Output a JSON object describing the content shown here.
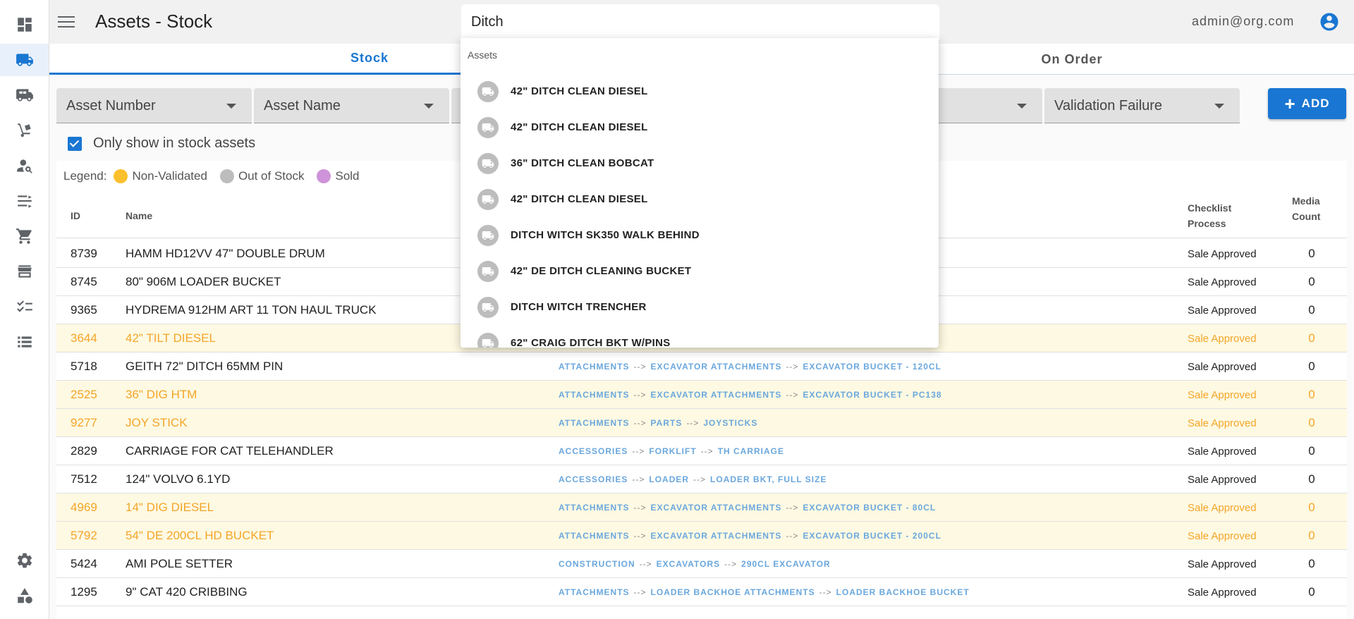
{
  "header": {
    "title": "Assets - Stock",
    "search_value": "Ditch",
    "user_email": "admin@org.com"
  },
  "tabs": [
    {
      "label": "Stock",
      "active": true
    },
    {
      "label": "On Order",
      "active": false
    }
  ],
  "filters": {
    "asset_number": "Asset Number",
    "asset_name": "Asset Name",
    "validation_failure": "Validation Failure",
    "add_label": "ADD"
  },
  "only_in_stock": {
    "label": "Only show in stock assets",
    "checked": true
  },
  "legend": {
    "label": "Legend:",
    "entries": [
      {
        "label": "Non-Validated",
        "color": "#fbc02d"
      },
      {
        "label": "Out of Stock",
        "color": "#bdbdbd"
      },
      {
        "label": "Sold",
        "color": "#ce93d8"
      }
    ]
  },
  "table": {
    "columns": {
      "id": "ID",
      "name": "Name",
      "checklist_1": "Checklist",
      "checklist_2": "Process",
      "media_1": "Media",
      "media_2": "Count"
    },
    "rows": [
      {
        "id": "8739",
        "name": "HAMM HD12VV 47\" DOUBLE DRUM",
        "cat": [
          "",
          "",
          ""
        ],
        "checklist": "Sale Approved",
        "media": "0",
        "nonval": false
      },
      {
        "id": "8745",
        "name": "80\" 906M LOADER BUCKET",
        "cat": [
          "",
          "",
          ""
        ],
        "checklist": "Sale Approved",
        "media": "0",
        "nonval": false
      },
      {
        "id": "9365",
        "name": "HYDREMA 912HM ART 11 TON HAUL TRUCK",
        "cat": [
          "",
          "",
          ""
        ],
        "checklist": "Sale Approved",
        "media": "0",
        "nonval": false
      },
      {
        "id": "3644",
        "name": "42\" TILT DIESEL",
        "cat": [
          "",
          "",
          ""
        ],
        "checklist": "Sale Approved",
        "media": "0",
        "nonval": true
      },
      {
        "id": "5718",
        "name": "GEITH 72\" DITCH 65MM PIN",
        "cat": [
          "ATTACHMENTS",
          "EXCAVATOR ATTACHMENTS",
          "EXCAVATOR BUCKET - 120CL"
        ],
        "checklist": "Sale Approved",
        "media": "0",
        "nonval": false
      },
      {
        "id": "2525",
        "name": "36\" DIG HTM",
        "cat": [
          "ATTACHMENTS",
          "EXCAVATOR ATTACHMENTS",
          "EXCAVATOR BUCKET - PC138"
        ],
        "checklist": "Sale Approved",
        "media": "0",
        "nonval": true
      },
      {
        "id": "9277",
        "name": "JOY STICK",
        "cat": [
          "ATTACHMENTS",
          "PARTS",
          "JOYSTICKS"
        ],
        "checklist": "Sale Approved",
        "media": "0",
        "nonval": true
      },
      {
        "id": "2829",
        "name": "CARRIAGE FOR CAT TELEHANDLER",
        "cat": [
          "ACCESSORIES",
          "FORKLIFT",
          "TH CARRIAGE"
        ],
        "checklist": "Sale Approved",
        "media": "0",
        "nonval": false
      },
      {
        "id": "7512",
        "name": "124\" VOLVO 6.1YD",
        "cat": [
          "ACCESSORIES",
          "LOADER",
          "LOADER BKT, FULL SIZE"
        ],
        "checklist": "Sale Approved",
        "media": "0",
        "nonval": false
      },
      {
        "id": "4969",
        "name": "14\" DIG DIESEL",
        "cat": [
          "ATTACHMENTS",
          "EXCAVATOR ATTACHMENTS",
          "EXCAVATOR BUCKET - 80CL"
        ],
        "checklist": "Sale Approved",
        "media": "0",
        "nonval": true
      },
      {
        "id": "5792",
        "name": "54\" DE 200CL HD BUCKET",
        "cat": [
          "ATTACHMENTS",
          "EXCAVATOR ATTACHMENTS",
          "EXCAVATOR BUCKET - 200CL"
        ],
        "checklist": "Sale Approved",
        "media": "0",
        "nonval": true
      },
      {
        "id": "5424",
        "name": "AMI POLE SETTER",
        "cat": [
          "CONSTRUCTION",
          "EXCAVATORS",
          "290CL EXCAVATOR"
        ],
        "checklist": "Sale Approved",
        "media": "0",
        "nonval": false
      },
      {
        "id": "1295",
        "name": "9\" CAT 420 CRIBBING",
        "cat": [
          "ATTACHMENTS",
          "LOADER BACKHOE ATTACHMENTS",
          "LOADER BACKHOE BUCKET"
        ],
        "checklist": "Sale Approved",
        "media": "0",
        "nonval": false
      }
    ],
    "arrow": "-->"
  },
  "dropdown": {
    "header": "Assets",
    "items": [
      "42\" DITCH CLEAN DIESEL",
      "42\" DITCH CLEAN DIESEL",
      "36\" DITCH CLEAN BOBCAT",
      "42\" DITCH CLEAN DIESEL",
      "DITCH WITCH SK350 WALK BEHIND",
      "42\" DE DITCH CLEANING BUCKET",
      "DITCH WITCH TRENCHER",
      "62\" CRAIG DITCH BKT W/PINS"
    ]
  },
  "sidebar": {
    "items": [
      {
        "icon": "dashboard-icon",
        "active": false
      },
      {
        "icon": "truck-icon",
        "active": true
      },
      {
        "icon": "truck-loaded-icon",
        "active": false
      },
      {
        "icon": "hand-truck-icon",
        "active": false
      },
      {
        "icon": "person-search-icon",
        "active": false
      },
      {
        "icon": "transfer-icon",
        "active": false
      },
      {
        "icon": "cart-icon",
        "active": false
      },
      {
        "icon": "store-icon",
        "active": false
      },
      {
        "icon": "checklist-icon",
        "active": false
      },
      {
        "icon": "list-icon",
        "active": false
      }
    ],
    "bottom": [
      {
        "icon": "gear-icon"
      },
      {
        "icon": "shapes-icon"
      }
    ]
  }
}
